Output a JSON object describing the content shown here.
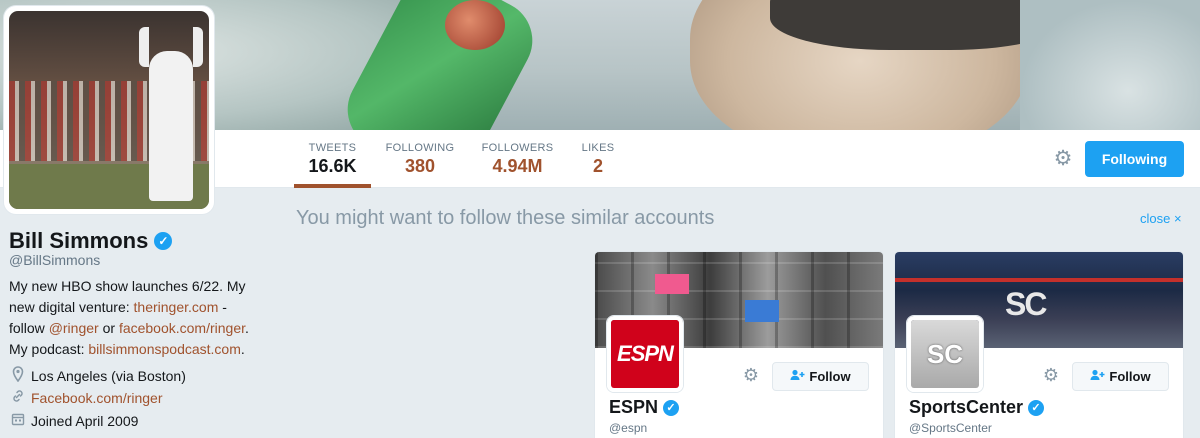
{
  "profile": {
    "name": "Bill Simmons",
    "handle": "@BillSimmons",
    "bio": {
      "part1": "My new HBO show launches 6/22. My new digital venture: ",
      "link1": "theringer.com",
      "part2": " - follow ",
      "link2": "@ringer",
      "part3": " or ",
      "link3": "facebook.com/ringer",
      "part4": ". My podcast: ",
      "link4": "billsimmonspodcast.com",
      "part5": "."
    },
    "location": "Los Angeles (via Boston)",
    "website": "Facebook.com/ringer",
    "joined": "Joined April 2009",
    "verified_glyph": "✓"
  },
  "stats": [
    {
      "label": "TWEETS",
      "value": "16.6K"
    },
    {
      "label": "FOLLOWING",
      "value": "380"
    },
    {
      "label": "FOLLOWERS",
      "value": "4.94M"
    },
    {
      "label": "LIKES",
      "value": "2"
    }
  ],
  "actions": {
    "following_label": "Following",
    "gear_icon": "⚙"
  },
  "similar": {
    "title": "You might want to follow these similar accounts",
    "close_label": "close ×",
    "cards": [
      {
        "name": "ESPN",
        "handle": "@espn",
        "logo_text": "ESPN",
        "follow_label": "Follow"
      },
      {
        "name": "SportsCenter",
        "handle": "@SportsCenter",
        "logo_text": "SC",
        "follow_label": "Follow"
      }
    ]
  },
  "icons": {
    "location": "location-pin-icon",
    "link": "link-icon",
    "calendar": "calendar-icon",
    "person_plus": "person-plus-icon"
  },
  "colors": {
    "link": "#a0522d",
    "accent": "#1da1f2"
  }
}
